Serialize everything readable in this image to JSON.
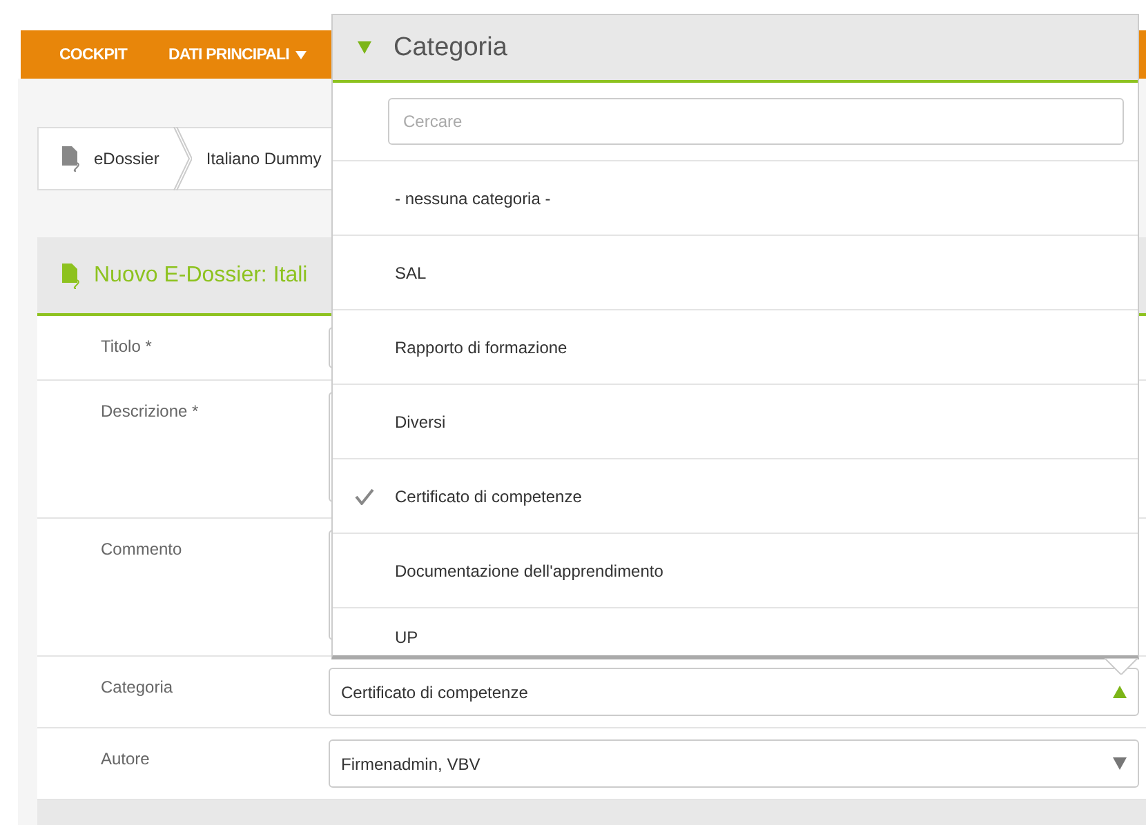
{
  "navbar": {
    "items": [
      {
        "label": "COCKPIT",
        "has_menu": false
      },
      {
        "label": "DATI PRINCIPALI",
        "has_menu": true
      }
    ]
  },
  "breadcrumb": [
    {
      "label": "eDossier",
      "kind": "root"
    },
    {
      "label": "Italiano Dummy",
      "kind": "item"
    }
  ],
  "panel": {
    "title": "Nuovo E-Dossier: Itali",
    "fields": [
      {
        "label": "Titolo *",
        "kind": "text"
      },
      {
        "label": "Descrizione *",
        "kind": "textarea"
      },
      {
        "label": "Commento",
        "kind": "textarea"
      },
      {
        "label": "Categoria",
        "kind": "select",
        "value": "Certificato di competenze",
        "open": true
      },
      {
        "label": "Autore",
        "kind": "select",
        "value": "Firmenadmin, VBV",
        "open": false
      }
    ]
  },
  "dropdown": {
    "title": "Categoria",
    "search": {
      "placeholder": "Cercare"
    },
    "options": [
      {
        "label": "- nessuna categoria -",
        "selected": false
      },
      {
        "label": "SAL",
        "selected": false
      },
      {
        "label": "Rapporto di formazione",
        "selected": false
      },
      {
        "label": "Diversi",
        "selected": false
      },
      {
        "label": "Certificato di competenze",
        "selected": true
      },
      {
        "label": "Documentazione dell'apprendimento",
        "selected": false
      },
      {
        "label": "UP",
        "selected": false
      }
    ]
  }
}
